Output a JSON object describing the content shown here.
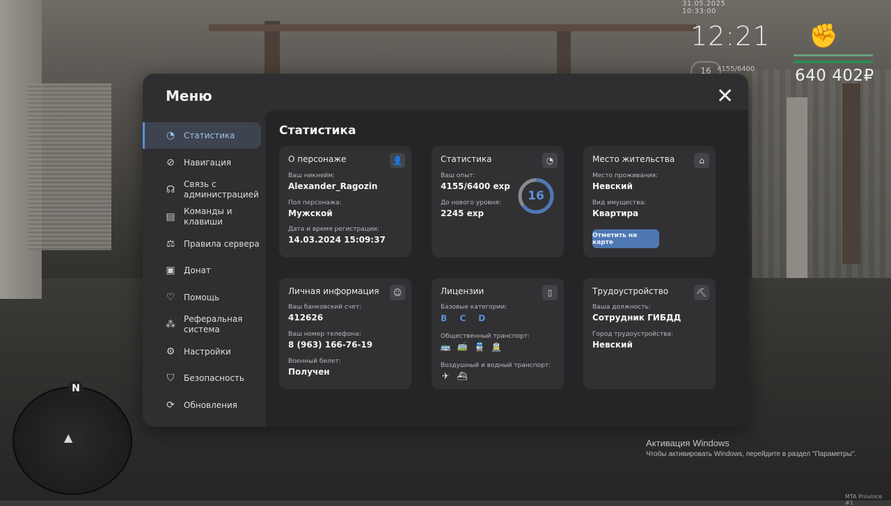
{
  "hud": {
    "date": "31.05.2025 10:33:00",
    "time": "12:21",
    "level": "16",
    "exp": "4155/6400",
    "money": "640 402₽"
  },
  "minimap": {
    "north": "N"
  },
  "windows_activation": {
    "title": "Активация Windows",
    "text": "Чтобы активировать Windows, перейдите в раздел \"Параметры\"."
  },
  "watermark": "MTA Province #1",
  "menu": {
    "title": "Меню",
    "close": "✕",
    "sidebar": [
      {
        "label": "Статистика",
        "icon": "pie-chart-icon",
        "active": true
      },
      {
        "label": "Навигация",
        "icon": "compass-icon"
      },
      {
        "label": "Связь с администрацией",
        "icon": "headset-icon"
      },
      {
        "label": "Команды и клавиши",
        "icon": "document-icon"
      },
      {
        "label": "Правила сервера",
        "icon": "scales-icon"
      },
      {
        "label": "Донат",
        "icon": "wallet-icon"
      },
      {
        "label": "Помощь",
        "icon": "handshake-icon"
      },
      {
        "label": "Реферальная система",
        "icon": "network-icon"
      },
      {
        "label": "Настройки",
        "icon": "gear-icon"
      },
      {
        "label": "Безопасность",
        "icon": "shield-icon"
      },
      {
        "label": "Обновления",
        "icon": "update-icon"
      }
    ],
    "content_title": "Статистика",
    "cards": {
      "character": {
        "title": "О персонаже",
        "nick_label": "Ваш никнейм:",
        "nick": "Alexander_Ragozin",
        "gender_label": "Пол персонажа:",
        "gender": "Мужской",
        "reg_label": "Дата и время регистрации:",
        "reg": "14.03.2024 15:09:37"
      },
      "stats": {
        "title": "Статистика",
        "exp_label": "Ваш опыт:",
        "exp": "4155/6400 exp",
        "next_label": "До нового уровня:",
        "next": "2245 exp",
        "level": "16",
        "progress": 0.649
      },
      "residence": {
        "title": "Место жительства",
        "place_label": "Место проживания:",
        "place": "Невский",
        "type_label": "Вид имущества:",
        "type": "Квартира",
        "button": "Отметить на карте"
      },
      "personal": {
        "title": "Личная информация",
        "bank_label": "Ваш банковский счет:",
        "bank": "412626",
        "phone_label": "Ваш номер телефона:",
        "phone": "8 (963) 166-76-19",
        "military_label": "Военный билет:",
        "military": "Получен"
      },
      "licenses": {
        "title": "Лицензии",
        "base_label": "Базовые категории:",
        "base": "B C D",
        "public_label": "Общественный транспорт:",
        "air_label": "Воздушный и водный транспорт:"
      },
      "employment": {
        "title": "Трудоустройство",
        "position_label": "Ваша должность:",
        "position": "Сотрудник ГИБДД",
        "city_label": "Город трудоустройства:",
        "city": "Невский"
      }
    }
  },
  "colors": {
    "accent": "#5b8fd6",
    "button": "#4f78b3",
    "panel": "#2f2f31",
    "card": "#313134"
  }
}
